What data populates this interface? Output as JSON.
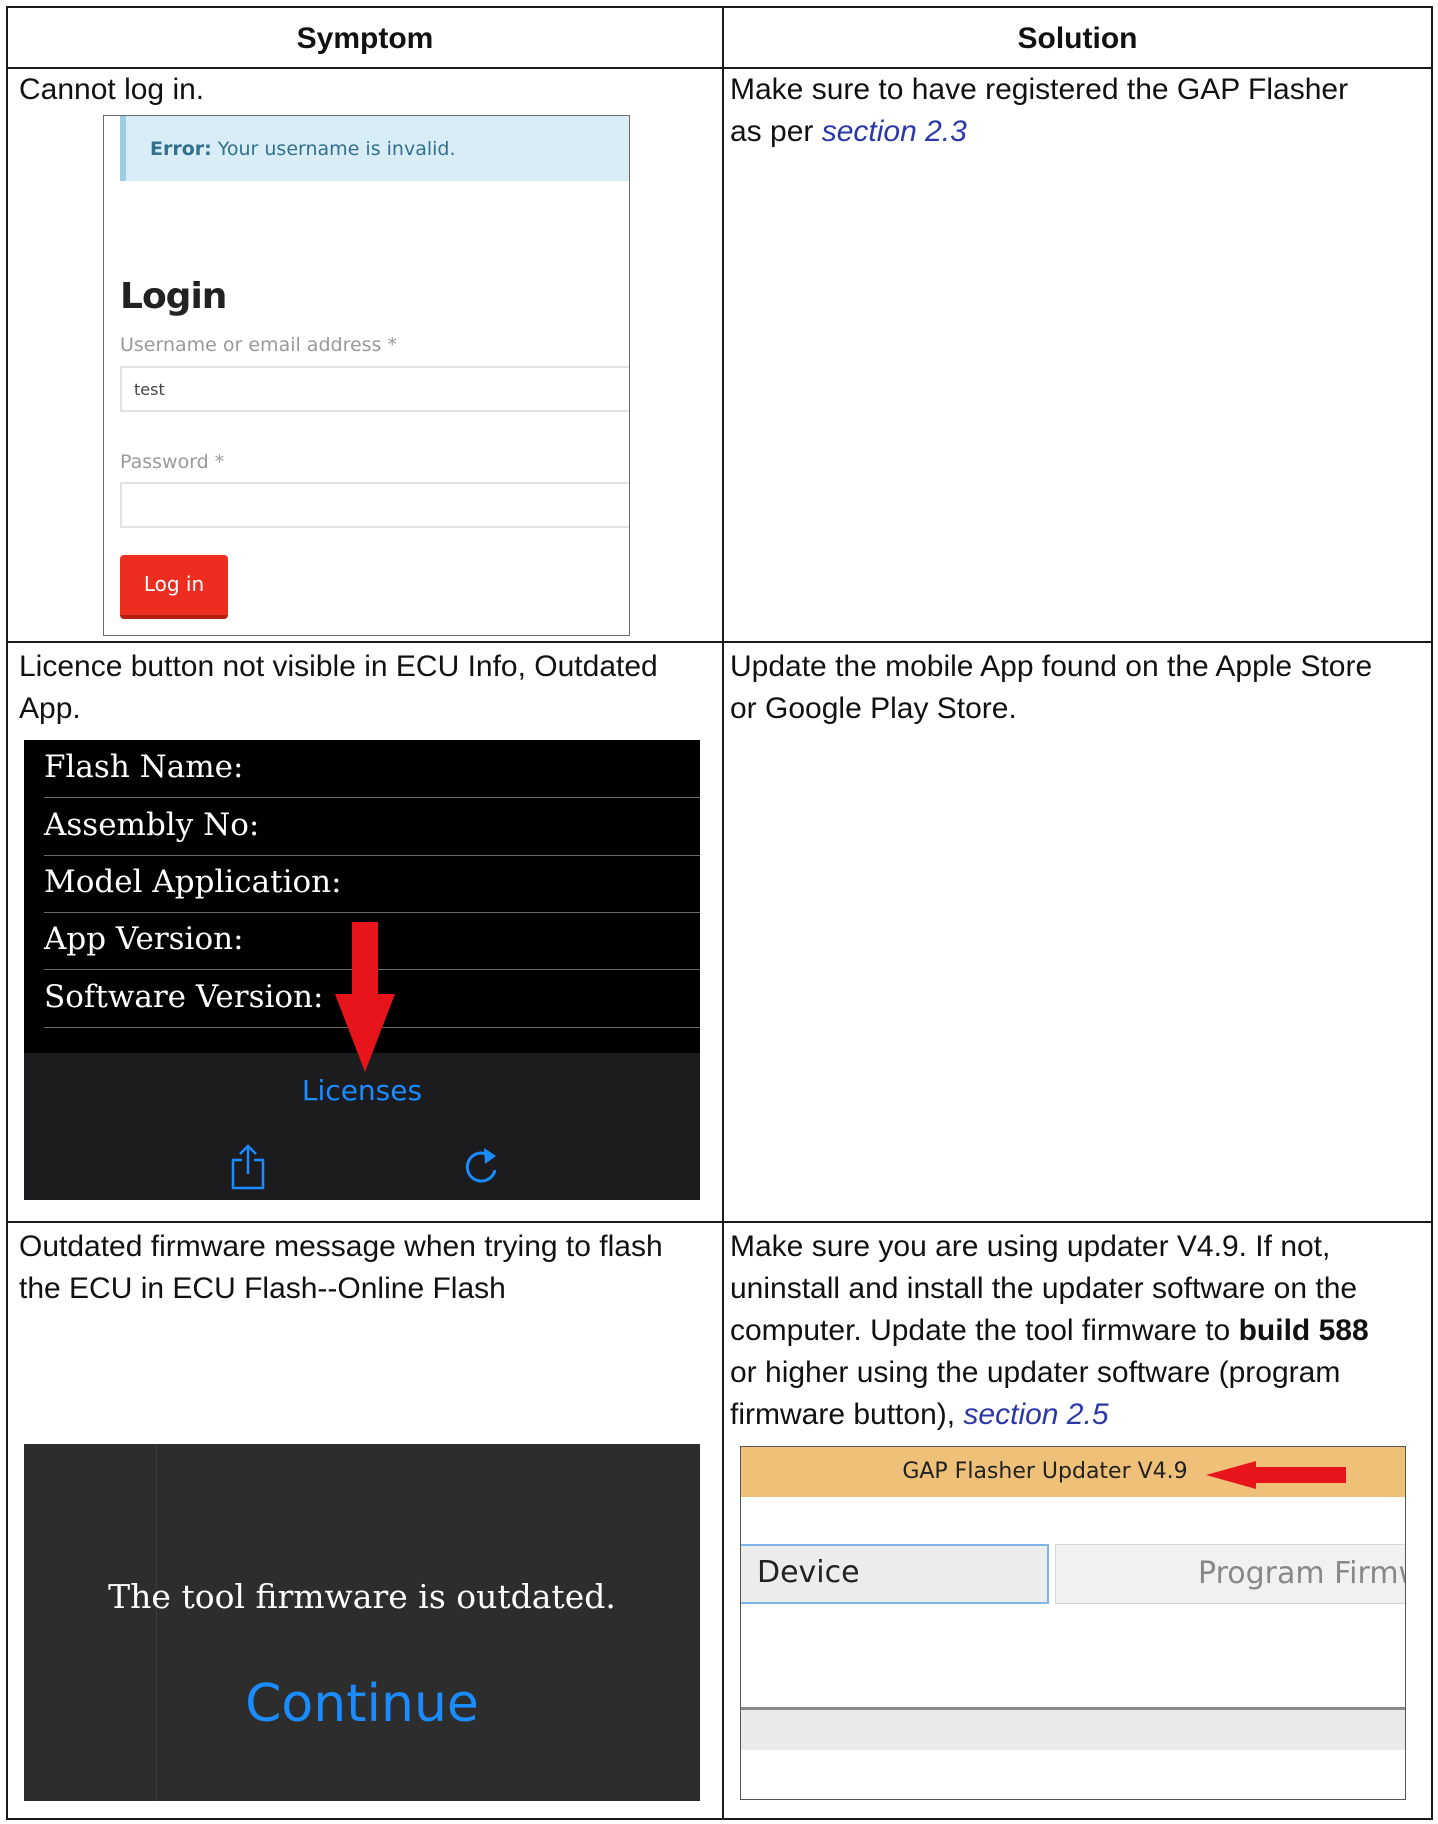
{
  "table": {
    "header": {
      "symptom": "Symptom",
      "solution": "Solution"
    },
    "rows": [
      {
        "symptom": "Cannot log in.",
        "solution_parts": [
          "Make sure to have registered the GAP Flasher",
          "as per ",
          "section 2.3"
        ]
      },
      {
        "symptom_lines": [
          "Licence button not visible in ECU Info, Outdated",
          "App."
        ],
        "solution_lines": [
          "Update the mobile App found on the Apple Store",
          "or Google Play Store."
        ]
      },
      {
        "symptom_lines": [
          "Outdated firmware message when trying to flash",
          "the ECU in ECU Flash--Online Flash"
        ],
        "solution_lines": [
          "Make sure you are using updater V4.9. If not,",
          "uninstall and install the updater software on the",
          "computer. Update the tool firmware to ",
          "build 588",
          "or higher using the updater software (program",
          "firmware button), ",
          "section 2.5"
        ]
      }
    ]
  },
  "login_screenshot": {
    "error_prefix": "Error:",
    "error_text": " Your username is invalid.",
    "title": "Login",
    "username_label": "Username or email address *",
    "username_value": "test",
    "password_label": "Password *",
    "button": "Log in"
  },
  "ecu_screenshot": {
    "fields": [
      "Flash Name:",
      "Assembly No:",
      "Model Application:",
      "App Version:",
      "Software Version:"
    ],
    "licenses_label": "Licenses",
    "icons": [
      "share-icon",
      "refresh-icon"
    ]
  },
  "firmware_screenshot": {
    "message": "The tool firmware is outdated.",
    "continue": "Continue"
  },
  "updater_screenshot": {
    "title": "GAP Flasher Updater V4.9",
    "tab_device": "Device",
    "tab_program": "Program Firmw"
  },
  "colors": {
    "link": "#2b38a8",
    "ios_blue": "#1a8cff",
    "login_red": "#ed2d1f",
    "arrow_red": "#e8141b",
    "updater_title": "#efc077"
  }
}
